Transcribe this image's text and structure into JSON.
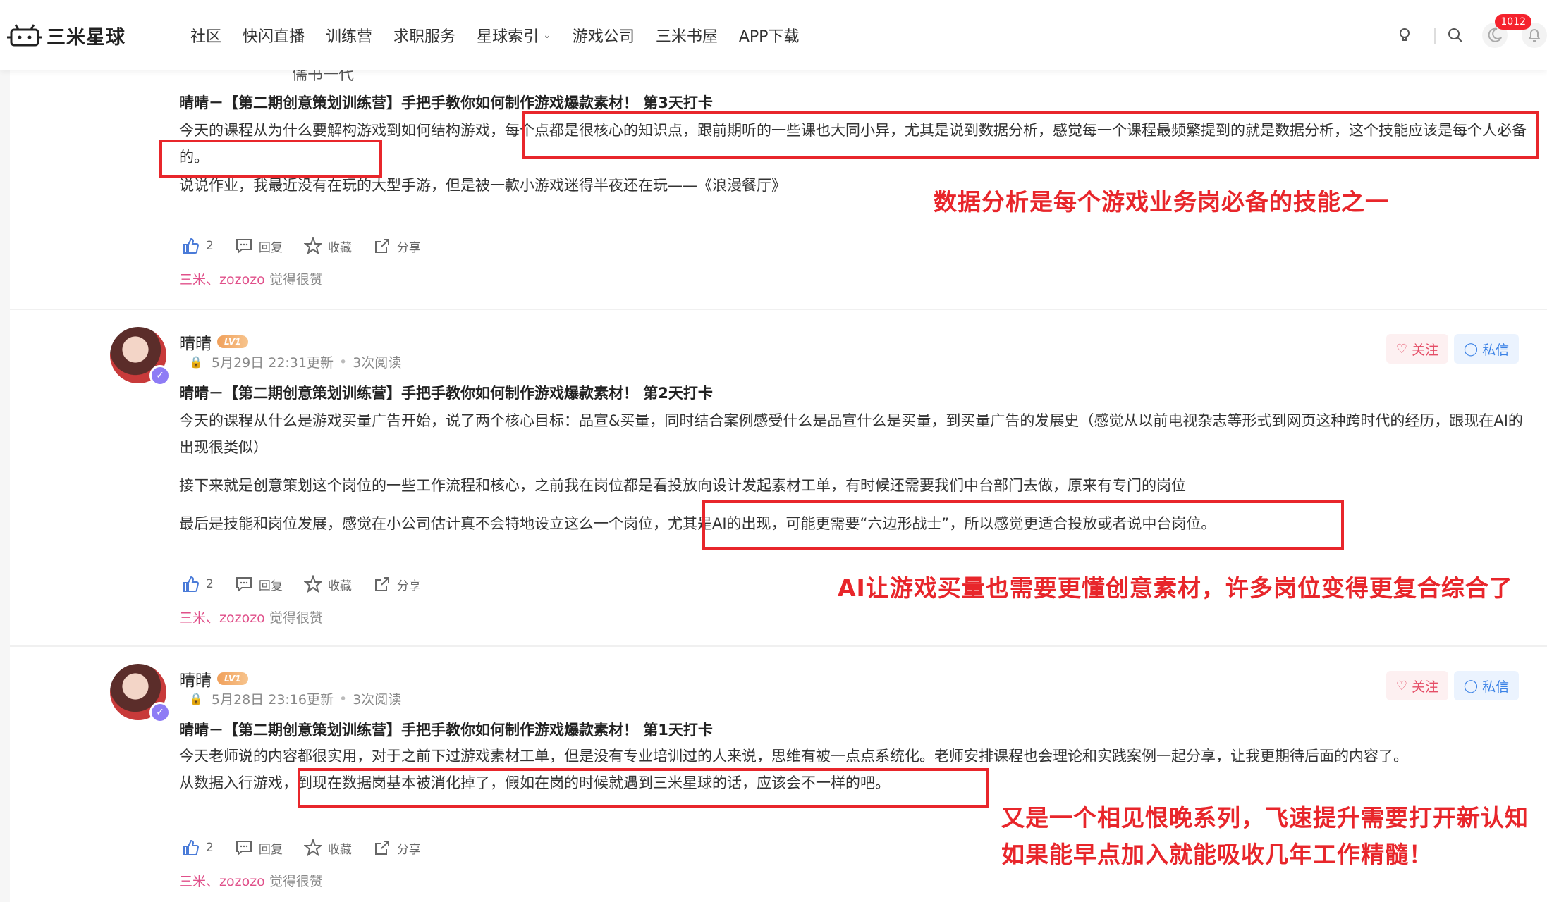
{
  "nav": {
    "logo_text": "三米星球",
    "items": [
      "社区",
      "快闪直播",
      "训练营",
      "求职服务",
      "星球索引",
      "游戏公司",
      "三米书屋",
      "APP下载"
    ],
    "notification_count": "1012"
  },
  "top_cut_text": "儒书一代",
  "posts": [
    {
      "title": "晴晴－【第二期创意策划训练营】手把手教你如何制作游戏爆款素材！ 第3天打卡",
      "para1_a": "今天的课程从为什么要解构游戏到如何结构游戏，",
      "para1_b": "每个点都是很核心的知识点，跟前期听的一些课也大同小异，尤其是说到数据分析，感觉每一个课程最频繁提到的就是数据分析，这个技能应该是每个人必备的。",
      "para2": "说说作业，我最近没有在玩的大型手游，但是被一款小游戏迷得半夜还在玩——《浪漫餐厅》",
      "likes": "2",
      "reply": "回复",
      "collect": "收藏",
      "share": "分享",
      "liker_names": "三米、zozozo",
      "liker_suffix": " 觉得很赞",
      "note": "数据分析是每个游戏业务岗必备的技能之一"
    },
    {
      "username": "晴晴",
      "level": "LV1",
      "updated": "5月29日 22:31更新",
      "reads": "3次阅读",
      "follow": "关注",
      "message": "私信",
      "title": "晴晴－【第二期创意策划训练营】手把手教你如何制作游戏爆款素材！ 第2天打卡",
      "para1": "今天的课程从什么是游戏买量广告开始，说了两个核心目标：品宣&买量，同时结合案例感受什么是品宣什么是买量，到买量广告的发展史（感觉从以前电视杂志等形式到网页这种跨时代的经历，跟现在AI的出现很类似）",
      "para2": "接下来就是创意策划这个岗位的一些工作流程和核心，之前我在岗位都是看投放向设计发起素材工单，有时候还需要我们中台部门去做，原来有专门的岗位",
      "para3_a": "最后是技能和岗位发展，感觉在小公司估计真不会特地设立这么一个岗位，",
      "para3_b": "尤其是AI的出现，可能更需要“六边形战士”，所以感觉更适合投放或者说中台岗位。",
      "likes": "2",
      "reply": "回复",
      "collect": "收藏",
      "share": "分享",
      "liker_names": "三米、zozozo",
      "liker_suffix": " 觉得很赞",
      "note": "AI让游戏买量也需要更懂创意素材，许多岗位变得更复合综合了"
    },
    {
      "username": "晴晴",
      "level": "LV1",
      "updated": "5月28日 23:16更新",
      "reads": "3次阅读",
      "follow": "关注",
      "message": "私信",
      "title": "晴晴－【第二期创意策划训练营】手把手教你如何制作游戏爆款素材！ 第1天打卡",
      "para1": "今天老师说的内容都很实用，对于之前下过游戏素材工单，但是没有专业培训过的人来说，思维有被一点点系统化。老师安排课程也会理论和实践案例一起分享，让我更期待后面的内容了。",
      "para2_a": "从数据入行游戏，",
      "para2_b": "到现在数据岗基本被消化掉了，假如在岗的时候就遇到三米星球的话，应该会不一样的吧。",
      "likes": "2",
      "reply": "回复",
      "collect": "收藏",
      "share": "分享",
      "liker_names": "三米、zozozo",
      "liker_suffix": " 觉得很赞",
      "note_line1": "又是一个相见恨晚系列，飞速提升需要打开新认知",
      "note_line2": "如果能早点加入就能吸收几年工作精髓！"
    }
  ],
  "colors": {
    "annotation_red": "#e8262b",
    "follow_pink": "#e54d66",
    "message_blue": "#3b82e6",
    "liker_pink": "#e0508a",
    "badge_red": "#f5222d"
  }
}
